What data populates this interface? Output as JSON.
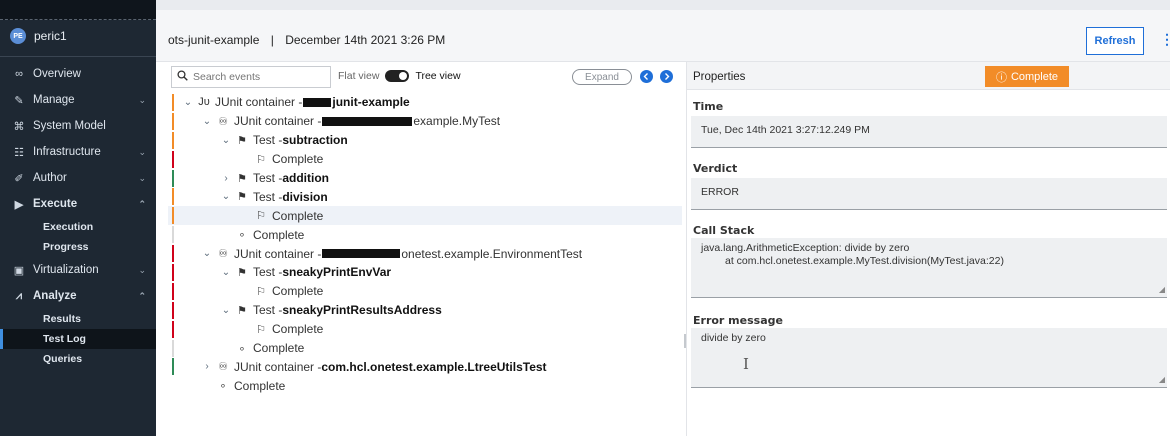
{
  "sidebar": {
    "user": {
      "initials": "PE",
      "name": "peric1"
    },
    "items": [
      {
        "icon": "∞",
        "label": "Overview",
        "chevron": ""
      },
      {
        "icon": "✎",
        "label": "Manage",
        "chevron": "⌄"
      },
      {
        "icon": "⌘",
        "label": "System Model",
        "chevron": ""
      },
      {
        "icon": "☷",
        "label": "Infrastructure",
        "chevron": "⌄"
      },
      {
        "icon": "✐",
        "label": "Author",
        "chevron": "⌄"
      },
      {
        "icon": "▶",
        "label": "Execute",
        "chevron": "⌃"
      }
    ],
    "execute_sub": [
      "Execution",
      "Progress"
    ],
    "items2": [
      {
        "icon": "▣",
        "label": "Virtualization",
        "chevron": "⌄"
      },
      {
        "icon": "⩘",
        "label": "Analyze",
        "chevron": "⌃"
      }
    ],
    "analyze_sub": [
      "Results",
      "Test Log",
      "Queries"
    ]
  },
  "header": {
    "project": "ots-junit-example",
    "separator": "|",
    "date": "December 14th 2021 3:26 PM",
    "refresh": "Refresh",
    "more": "⋮"
  },
  "events": {
    "search_placeholder": "Search events",
    "flat_view": "Flat view",
    "tree_view": "Tree view",
    "expand": "Expand",
    "rows": [
      {
        "bar": "#f28c28",
        "indent": 0,
        "chev": "⌄",
        "icon": "Jᴜ",
        "prefix": "JUnit container -",
        "redact": 28,
        "bold": "junit-example",
        "normal": "",
        "selected": false
      },
      {
        "bar": "#f28c28",
        "indent": 1,
        "chev": "⌄",
        "icon": "♾",
        "prefix": "JUnit container -",
        "redact": 90,
        "bold": "",
        "normal": "example.MyTest",
        "selected": false
      },
      {
        "bar": "#f28c28",
        "indent": 2,
        "chev": "⌄",
        "icon": "⚑",
        "prefix": "Test - ",
        "redact": 0,
        "bold": "subtraction",
        "normal": "",
        "selected": false
      },
      {
        "bar": "#d0021b",
        "indent": 3,
        "chev": "",
        "icon": "⚐",
        "prefix": "Complete",
        "redact": 0,
        "bold": "",
        "normal": "",
        "selected": false
      },
      {
        "bar": "#2e8b57",
        "indent": 2,
        "chev": "›",
        "icon": "⚑",
        "prefix": "Test - ",
        "redact": 0,
        "bold": "addition",
        "normal": "",
        "selected": false
      },
      {
        "bar": "#f28c28",
        "indent": 2,
        "chev": "⌄",
        "icon": "⚑",
        "prefix": "Test - ",
        "redact": 0,
        "bold": "division",
        "normal": "",
        "selected": false
      },
      {
        "bar": "#f28c28",
        "indent": 3,
        "chev": "",
        "icon": "⚐",
        "prefix": "Complete",
        "redact": 0,
        "bold": "",
        "normal": "",
        "selected": true
      },
      {
        "bar": "#d9d9d9",
        "indent": 2,
        "chev": "",
        "icon": "∘",
        "prefix": "Complete",
        "redact": 0,
        "bold": "",
        "normal": "",
        "selected": false
      },
      {
        "bar": "#d0021b",
        "indent": 1,
        "chev": "⌄",
        "icon": "♾",
        "prefix": "JUnit container -",
        "redact": 78,
        "bold": "",
        "normal": "onetest.example.EnvironmentTest",
        "selected": false
      },
      {
        "bar": "#d0021b",
        "indent": 2,
        "chev": "⌄",
        "icon": "⚑",
        "prefix": "Test - ",
        "redact": 0,
        "bold": "sneakyPrintEnvVar",
        "normal": "",
        "selected": false
      },
      {
        "bar": "#d0021b",
        "indent": 3,
        "chev": "",
        "icon": "⚐",
        "prefix": "Complete",
        "redact": 0,
        "bold": "",
        "normal": "",
        "selected": false
      },
      {
        "bar": "#d0021b",
        "indent": 2,
        "chev": "⌄",
        "icon": "⚑",
        "prefix": "Test - ",
        "redact": 0,
        "bold": "sneakyPrintResultsAddress",
        "normal": "",
        "selected": false
      },
      {
        "bar": "#d0021b",
        "indent": 3,
        "chev": "",
        "icon": "⚐",
        "prefix": "Complete",
        "redact": 0,
        "bold": "",
        "normal": "",
        "selected": false
      },
      {
        "bar": "#d9d9d9",
        "indent": 2,
        "chev": "",
        "icon": "∘",
        "prefix": "Complete",
        "redact": 0,
        "bold": "",
        "normal": "",
        "selected": false
      },
      {
        "bar": "#2e8b57",
        "indent": 1,
        "chev": "›",
        "icon": "♾",
        "prefix": "JUnit container - ",
        "redact": 0,
        "bold": "com.hcl.onetest.example.LtreeUtilsTest",
        "normal": "",
        "selected": false
      },
      {
        "bar": "",
        "indent": 1,
        "chev": "",
        "icon": "∘",
        "prefix": "Complete",
        "redact": 0,
        "bold": "",
        "normal": "",
        "selected": false
      }
    ]
  },
  "properties": {
    "title": "Properties",
    "status": "Complete",
    "status_icon": "ⓘ",
    "time_label": "Time",
    "time_value": "Tue, Dec 14th 2021 3:27:12.249 PM",
    "verdict_label": "Verdict",
    "verdict_value": "ERROR",
    "callstack_label": "Call Stack",
    "callstack_line1": "java.lang.ArithmeticException: divide by zero",
    "callstack_line2": "at com.hcl.onetest.example.MyTest.division(MyTest.java:22)",
    "error_label": "Error message",
    "error_value": "divide by zero"
  },
  "colors": {
    "accent": "#1f6fd8",
    "status_orange": "#f28c28",
    "error_red": "#d0021b",
    "pass_green": "#2e8b57",
    "sidebar_bg": "#1e2833"
  }
}
